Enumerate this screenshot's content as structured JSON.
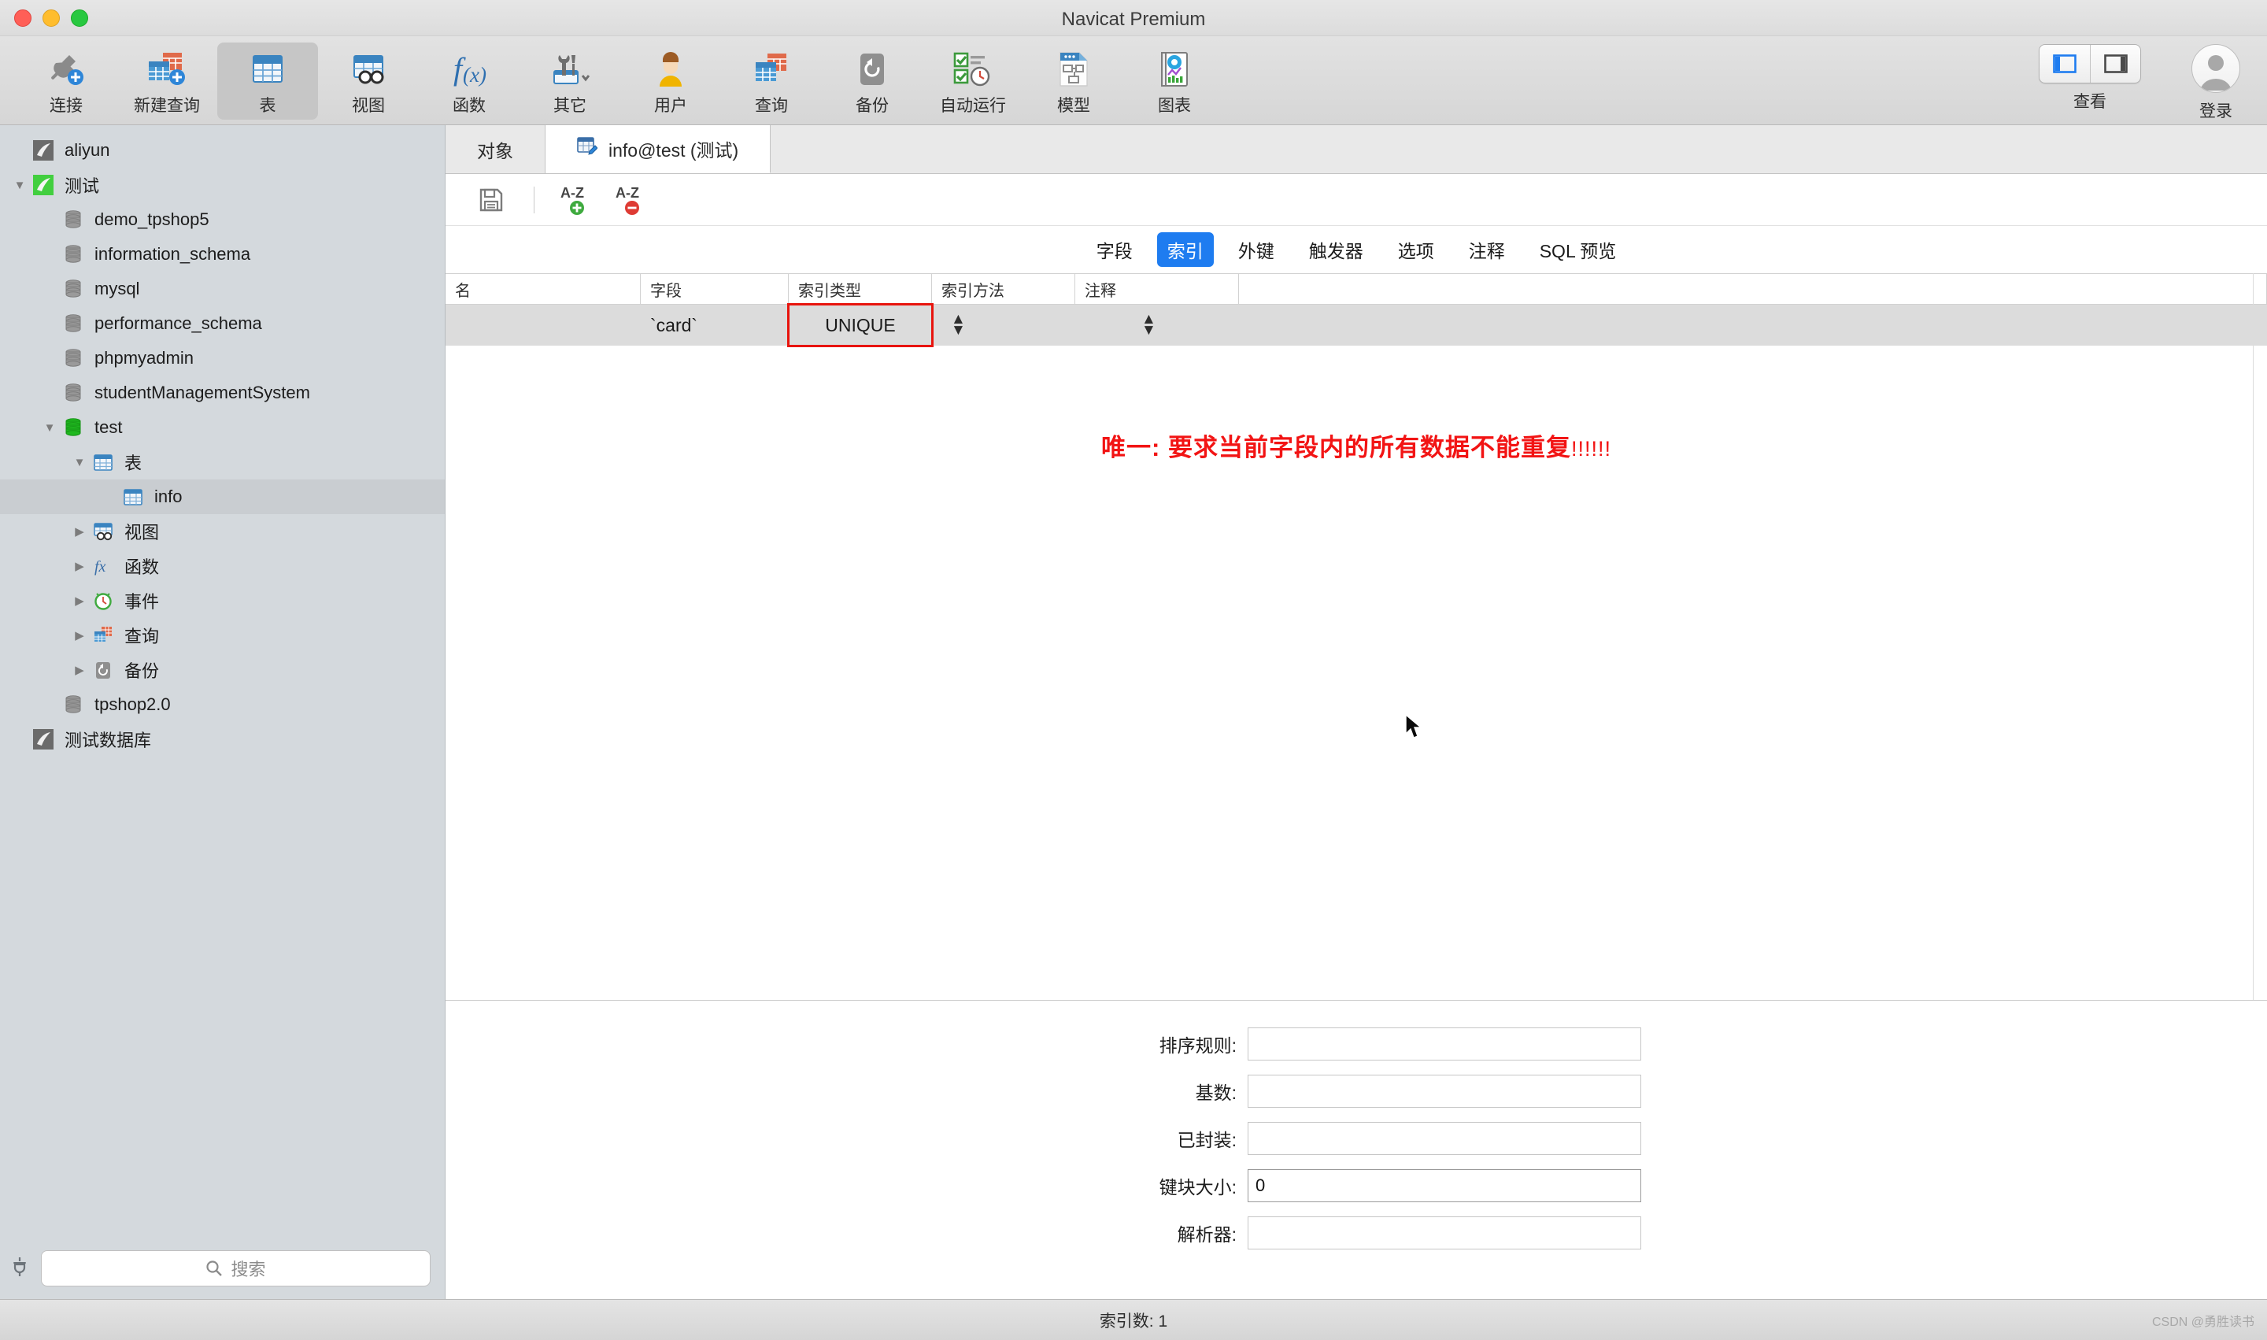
{
  "window": {
    "title": "Navicat Premium"
  },
  "toolbar": {
    "items": [
      {
        "label": "连接",
        "icon": "connection-icon",
        "active": false
      },
      {
        "label": "新建查询",
        "icon": "new-query-icon",
        "active": false
      },
      {
        "label": "表",
        "icon": "table-icon",
        "active": true
      },
      {
        "label": "视图",
        "icon": "view-icon",
        "active": false
      },
      {
        "label": "函数",
        "icon": "function-icon",
        "active": false
      },
      {
        "label": "其它",
        "icon": "other-tools-icon",
        "active": false
      },
      {
        "label": "用户",
        "icon": "user-icon",
        "active": false
      },
      {
        "label": "查询",
        "icon": "query-icon",
        "active": false
      },
      {
        "label": "备份",
        "icon": "backup-icon",
        "active": false
      },
      {
        "label": "自动运行",
        "icon": "automation-icon",
        "active": false
      },
      {
        "label": "模型",
        "icon": "model-icon",
        "active": false
      },
      {
        "label": "图表",
        "icon": "chart-icon",
        "active": false
      }
    ],
    "view_label": "查看",
    "login_label": "登录"
  },
  "sidebar": {
    "tree": [
      {
        "label": "aliyun",
        "indent": 0,
        "twisty": "",
        "icon": "navicat-connection-gray-icon",
        "selected": false
      },
      {
        "label": "测试",
        "indent": 0,
        "twisty": "down",
        "icon": "navicat-connection-green-icon",
        "selected": false
      },
      {
        "label": "demo_tpshop5",
        "indent": 1,
        "twisty": "",
        "icon": "database-gray-icon",
        "selected": false
      },
      {
        "label": "information_schema",
        "indent": 1,
        "twisty": "",
        "icon": "database-gray-icon",
        "selected": false
      },
      {
        "label": "mysql",
        "indent": 1,
        "twisty": "",
        "icon": "database-gray-icon",
        "selected": false
      },
      {
        "label": "performance_schema",
        "indent": 1,
        "twisty": "",
        "icon": "database-gray-icon",
        "selected": false
      },
      {
        "label": "phpmyadmin",
        "indent": 1,
        "twisty": "",
        "icon": "database-gray-icon",
        "selected": false
      },
      {
        "label": "studentManagementSystem",
        "indent": 1,
        "twisty": "",
        "icon": "database-gray-icon",
        "selected": false
      },
      {
        "label": "test",
        "indent": 1,
        "twisty": "down",
        "icon": "database-green-icon",
        "selected": false
      },
      {
        "label": "表",
        "indent": 2,
        "twisty": "down",
        "icon": "tables-folder-icon",
        "selected": false
      },
      {
        "label": "info",
        "indent": 3,
        "twisty": "",
        "icon": "table-item-icon",
        "selected": true
      },
      {
        "label": "视图",
        "indent": 2,
        "twisty": "right",
        "icon": "views-folder-icon",
        "selected": false
      },
      {
        "label": "函数",
        "indent": 2,
        "twisty": "right",
        "icon": "functions-folder-icon",
        "selected": false
      },
      {
        "label": "事件",
        "indent": 2,
        "twisty": "right",
        "icon": "events-folder-icon",
        "selected": false
      },
      {
        "label": "查询",
        "indent": 2,
        "twisty": "right",
        "icon": "queries-folder-icon",
        "selected": false
      },
      {
        "label": "备份",
        "indent": 2,
        "twisty": "right",
        "icon": "backups-folder-icon",
        "selected": false
      },
      {
        "label": "tpshop2.0",
        "indent": 1,
        "twisty": "",
        "icon": "database-gray-icon",
        "selected": false
      },
      {
        "label": "测试数据库",
        "indent": 0,
        "twisty": "",
        "icon": "navicat-connection-gray-icon",
        "selected": false
      }
    ],
    "search_placeholder": "搜索"
  },
  "main": {
    "tabs": [
      {
        "label": "对象",
        "icon": "",
        "active": false
      },
      {
        "label": "info@test (测试)",
        "icon": "table-edit-icon",
        "active": true
      }
    ],
    "editor_toolbar": [
      {
        "name": "save-icon",
        "label": "保存"
      },
      {
        "name": "sort-asc-icon",
        "label": "A-Z"
      },
      {
        "name": "sort-desc-icon",
        "label": "A-Z"
      }
    ],
    "subtabs": [
      {
        "label": "字段",
        "active": false
      },
      {
        "label": "索引",
        "active": true
      },
      {
        "label": "外键",
        "active": false
      },
      {
        "label": "触发器",
        "active": false
      },
      {
        "label": "选项",
        "active": false
      },
      {
        "label": "注释",
        "active": false
      },
      {
        "label": "SQL 预览",
        "active": false
      }
    ],
    "grid": {
      "columns": [
        "名",
        "字段",
        "索引类型",
        "索引方法",
        "注释"
      ],
      "rows": [
        {
          "name": "",
          "field": "`card`",
          "index_type": "UNIQUE",
          "index_method": "",
          "comment": ""
        }
      ]
    },
    "annotation": {
      "text": "唯一: 要求当前字段内的所有数据不能重复",
      "suffix": "!!!!!!",
      "color": "#f21414"
    },
    "properties": [
      {
        "label": "排序规则:",
        "value": ""
      },
      {
        "label": "基数:",
        "value": ""
      },
      {
        "label": "已封装:",
        "value": ""
      },
      {
        "label": "键块大小:",
        "value": "0"
      },
      {
        "label": "解析器:",
        "value": ""
      }
    ]
  },
  "statusbar": {
    "text": "索引数: 1",
    "watermark": "CSDN @勇胜读书"
  },
  "colors": {
    "accent_blue": "#1e7cf0",
    "annotation_red": "#f21414",
    "highlight_border": "#e8140d",
    "sidebar_bg": "#d4d9dd",
    "selected_row": "#dcdcdc"
  }
}
